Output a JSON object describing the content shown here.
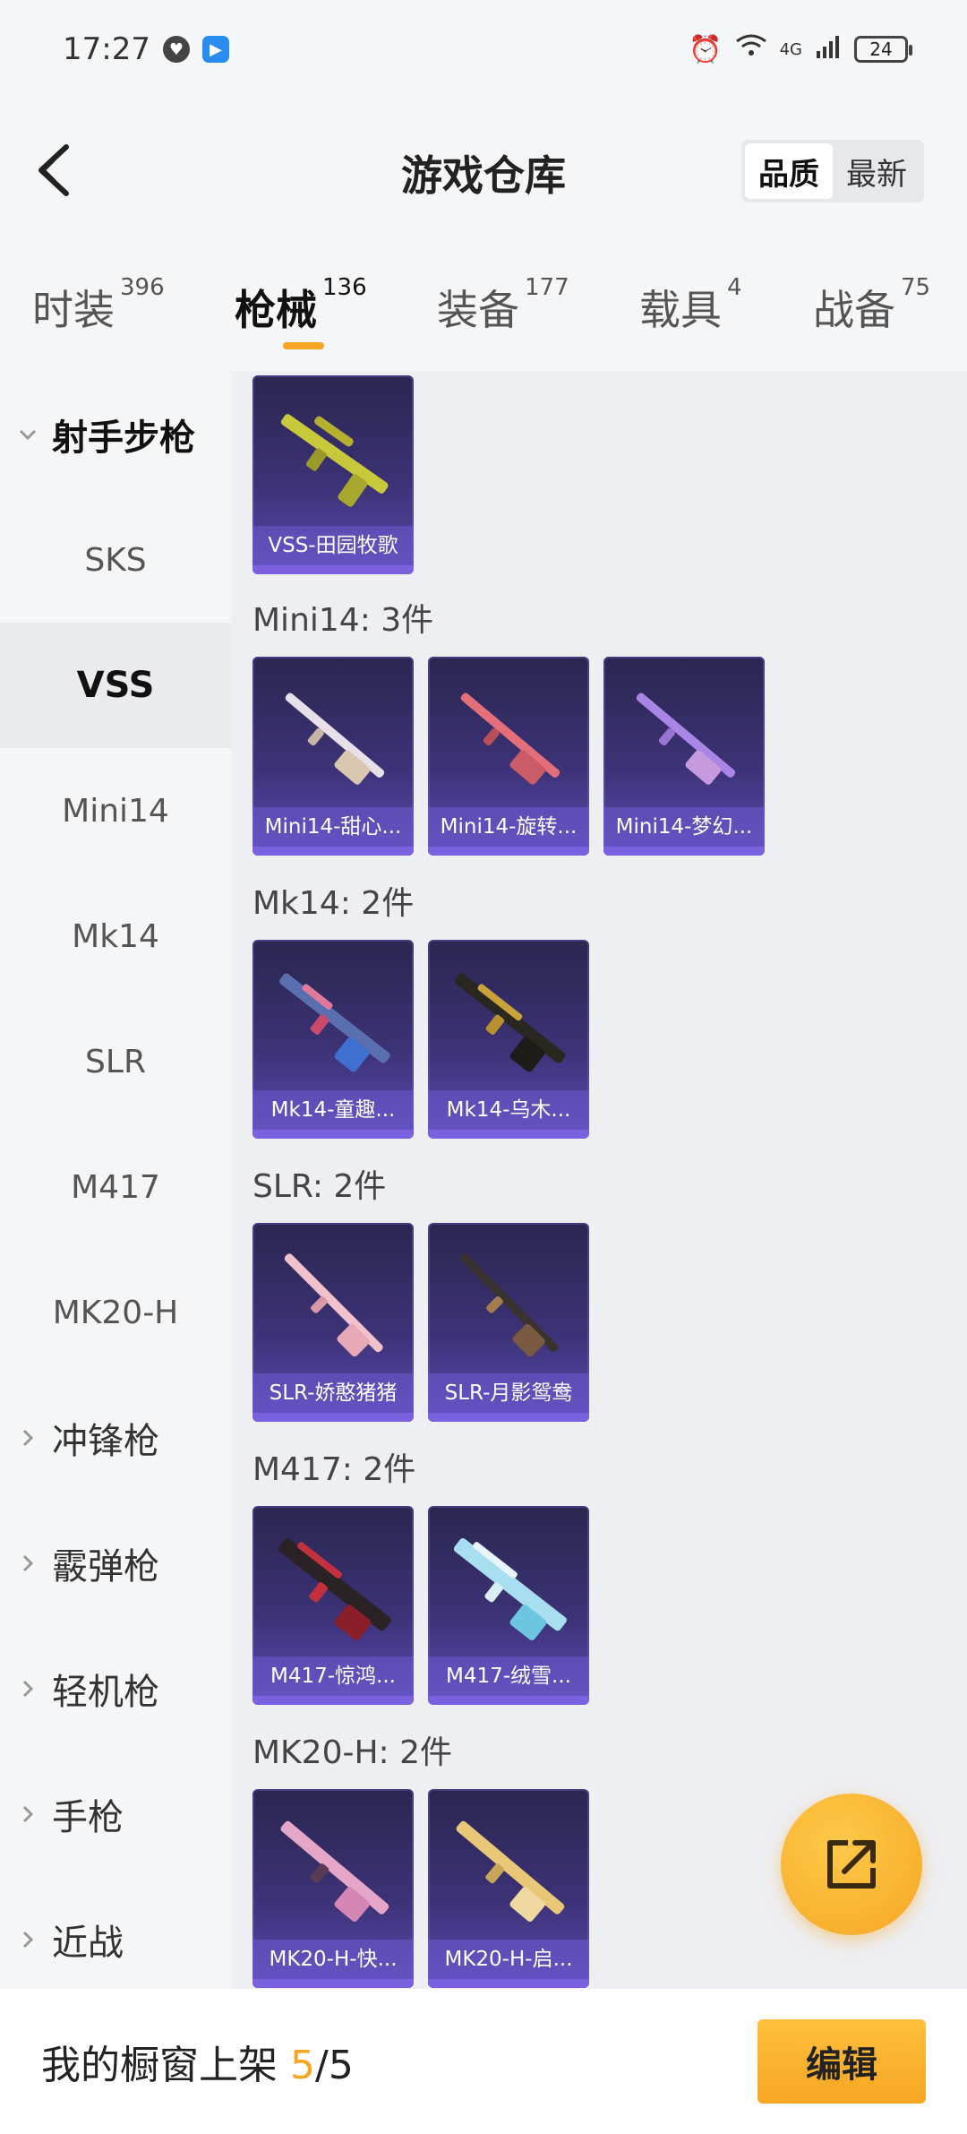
{
  "status_bar": {
    "time": "17:27",
    "battery": "24",
    "network": "4G"
  },
  "header": {
    "title": "游戏仓库",
    "sort_quality": "品质",
    "sort_newest": "最新"
  },
  "tabs": [
    {
      "label": "时装",
      "count": "396"
    },
    {
      "label": "枪械",
      "count": "136"
    },
    {
      "label": "装备",
      "count": "177"
    },
    {
      "label": "载具",
      "count": "4"
    },
    {
      "label": "战备",
      "count": "75"
    }
  ],
  "sidebar": {
    "open_category": "射手步枪",
    "sub_items": [
      "SKS",
      "VSS",
      "Mini14",
      "Mk14",
      "SLR",
      "M417",
      "MK20-H"
    ],
    "categories": [
      "冲锋枪",
      "霰弹枪",
      "轻机枪",
      "手枪",
      "近战"
    ]
  },
  "groups": [
    {
      "title": "",
      "items": [
        "VSS-田园牧歌"
      ]
    },
    {
      "title": "Mini14: 3件",
      "items": [
        "Mini14-甜心...",
        "Mini14-旋转...",
        "Mini14-梦幻..."
      ]
    },
    {
      "title": "Mk14: 2件",
      "items": [
        "Mk14-童趣...",
        "Mk14-乌木..."
      ]
    },
    {
      "title": "SLR: 2件",
      "items": [
        "SLR-娇憨猪猪",
        "SLR-月影鸳鸯"
      ]
    },
    {
      "title": "M417: 2件",
      "items": [
        "M417-惊鸿...",
        "M417-绒雪..."
      ]
    },
    {
      "title": "MK20-H: 2件",
      "items": [
        "MK20-H-快...",
        "MK20-H-启..."
      ]
    }
  ],
  "bottom_bar": {
    "label": "我的橱窗上架 ",
    "current": "5",
    "total": "/5",
    "edit_label": "编辑"
  },
  "colors": {
    "accent": "#f5a623",
    "card_top": "#2a2650",
    "card_bottom": "#5b4bb0"
  }
}
